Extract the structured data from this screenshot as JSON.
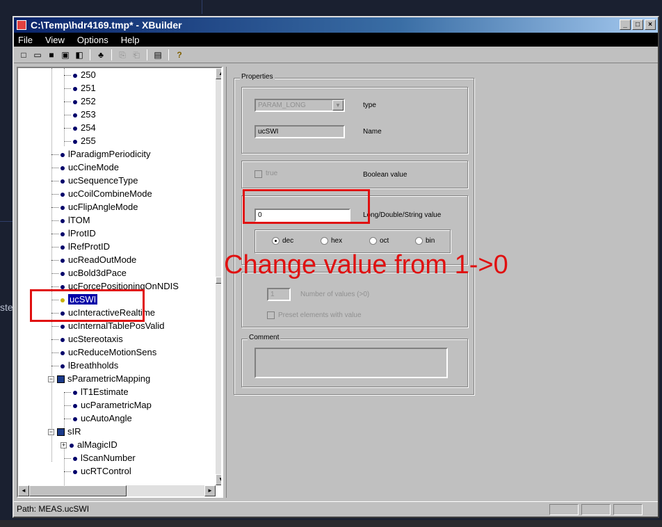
{
  "window": {
    "title": "C:\\Temp\\hdr4169.tmp* - XBuilder",
    "minimize_glyph": "_",
    "maximize_glyph": "□",
    "close_glyph": "×"
  },
  "desktop": {
    "left_label": "ste"
  },
  "menu": [
    "File",
    "View",
    "Options",
    "Help"
  ],
  "toolbar": [
    {
      "icon": "new-icon",
      "glyph": "□"
    },
    {
      "icon": "open-icon",
      "glyph": "▭"
    },
    {
      "icon": "save-icon",
      "glyph": "■"
    },
    {
      "icon": "tool-icon",
      "glyph": "▣"
    },
    {
      "icon": "tool-icon",
      "glyph": "◧"
    },
    {
      "icon": "find-icon",
      "glyph": "♣"
    },
    {
      "icon": "copy-icon",
      "glyph": "⎘"
    },
    {
      "icon": "paste-icon",
      "glyph": "⎗"
    },
    {
      "icon": "properties-icon",
      "glyph": "▤"
    },
    {
      "icon": "help-icon",
      "glyph": "?"
    }
  ],
  "tree": {
    "items": [
      {
        "label": "250",
        "indent": 2,
        "kind": "leaf"
      },
      {
        "label": "251",
        "indent": 2,
        "kind": "leaf"
      },
      {
        "label": "252",
        "indent": 2,
        "kind": "leaf"
      },
      {
        "label": "253",
        "indent": 2,
        "kind": "leaf"
      },
      {
        "label": "254",
        "indent": 2,
        "kind": "leaf"
      },
      {
        "label": "255",
        "indent": 2,
        "kind": "leaf"
      },
      {
        "label": "lParadigmPeriodicity",
        "indent": 1,
        "kind": "leaf"
      },
      {
        "label": "ucCineMode",
        "indent": 1,
        "kind": "leaf"
      },
      {
        "label": "ucSequenceType",
        "indent": 1,
        "kind": "leaf"
      },
      {
        "label": "ucCoilCombineMode",
        "indent": 1,
        "kind": "leaf"
      },
      {
        "label": "ucFlipAngleMode",
        "indent": 1,
        "kind": "leaf"
      },
      {
        "label": "lTOM",
        "indent": 1,
        "kind": "leaf"
      },
      {
        "label": "lProtID",
        "indent": 1,
        "kind": "leaf"
      },
      {
        "label": "lRefProtID",
        "indent": 1,
        "kind": "leaf"
      },
      {
        "label": "ucReadOutMode",
        "indent": 1,
        "kind": "leaf"
      },
      {
        "label": "ucBold3dPace",
        "indent": 1,
        "kind": "leaf"
      },
      {
        "label": "ucForcePositioningOnNDIS",
        "indent": 1,
        "kind": "leaf"
      },
      {
        "label": "ucSWI",
        "indent": 1,
        "kind": "selected"
      },
      {
        "label": "ucInteractiveRealtime",
        "indent": 1,
        "kind": "leaf"
      },
      {
        "label": "ucInternalTablePosValid",
        "indent": 1,
        "kind": "leaf"
      },
      {
        "label": "ucStereotaxis",
        "indent": 1,
        "kind": "leaf"
      },
      {
        "label": "ucReduceMotionSens",
        "indent": 1,
        "kind": "leaf"
      },
      {
        "label": "lBreathholds",
        "indent": 1,
        "kind": "leaf"
      },
      {
        "label": "sParametricMapping",
        "indent": 1,
        "kind": "folder",
        "expander": "−"
      },
      {
        "label": "lT1Estimate",
        "indent": 2,
        "kind": "leaf"
      },
      {
        "label": "ucParametricMap",
        "indent": 2,
        "kind": "leaf"
      },
      {
        "label": "ucAutoAngle",
        "indent": 2,
        "kind": "leaf"
      },
      {
        "label": "sIR",
        "indent": 1,
        "kind": "folder",
        "expander": "−"
      },
      {
        "label": "alMagicID",
        "indent": 2,
        "kind": "collapsed",
        "expander": "+"
      },
      {
        "label": "lScanNumber",
        "indent": 2,
        "kind": "leaf"
      },
      {
        "label": "ucRTControl",
        "indent": 2,
        "kind": "leaf"
      }
    ]
  },
  "properties": {
    "group_label": "Properties",
    "type_value": "PARAM_LONG",
    "type_label": "type",
    "name_value": "ucSWI",
    "name_label": "Name",
    "bool_check_label": "true",
    "bool_label": "Boolean value",
    "value_input": "0",
    "value_label": "Long/Double/String value",
    "radios": [
      {
        "label": "dec",
        "checked": true
      },
      {
        "label": "hex",
        "checked": false
      },
      {
        "label": "oct",
        "checked": false
      },
      {
        "label": "bin",
        "checked": false
      }
    ],
    "array_count": "1",
    "array_count_label": "Number of values (>0)",
    "preset_label": "Preset elements with value",
    "comment_label": "Comment"
  },
  "annotation": {
    "text": "Change value from 1->0",
    "color": "#e01010"
  },
  "status": {
    "path": "Path: MEAS.ucSWI"
  },
  "scroll": {
    "up": "▲",
    "down": "▼",
    "left": "◄",
    "right": "►"
  }
}
